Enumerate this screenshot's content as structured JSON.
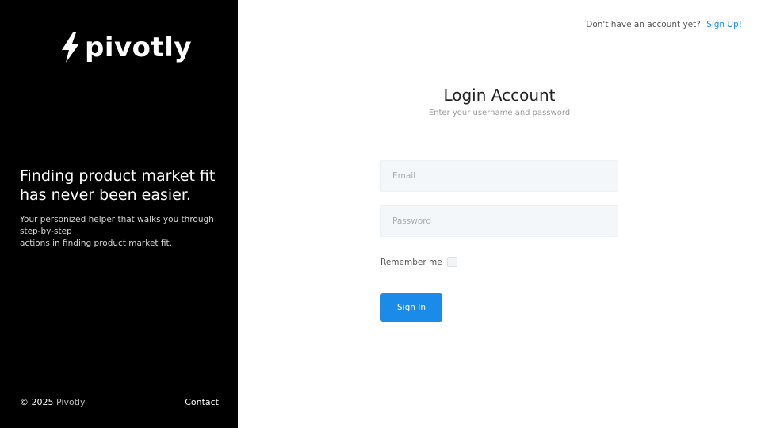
{
  "brand": {
    "logo_text": "pivotly",
    "logo_icon": "lightning-bolt-icon"
  },
  "hero": {
    "headline_line1": "Finding product market fit",
    "headline_line2": "has never been easier.",
    "desc_line1": "Your personized helper that walks you through step-by-step",
    "desc_line2": "actions in finding product market fit."
  },
  "footer": {
    "copyright_prefix": "© 2025",
    "copyright_brand": "Pivotly",
    "contact": "Contact"
  },
  "topnav": {
    "prompt": "Don't have an account yet?",
    "signup": "Sign Up!"
  },
  "form": {
    "title": "Login Account",
    "subtitle": "Enter your username and password",
    "email_placeholder": "Email",
    "password_placeholder": "Password",
    "remember_label": "Remember me",
    "submit": "Sign In"
  },
  "colors": {
    "accent": "#1a8be8",
    "sidebar": "#000000",
    "input_bg": "#f3f7fa"
  }
}
